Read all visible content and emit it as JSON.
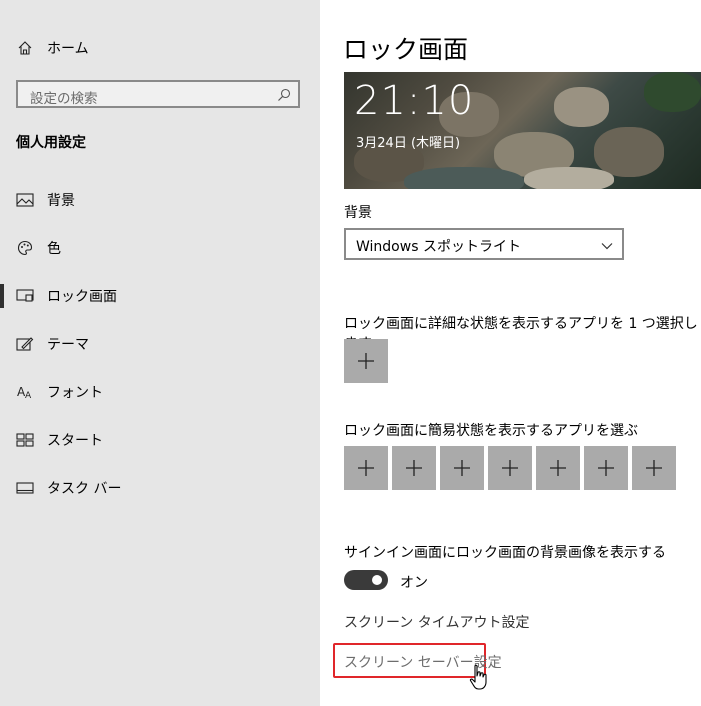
{
  "sidebar": {
    "home": {
      "label": "ホーム",
      "icon": "home-icon"
    },
    "search": {
      "placeholder": "設定の検索",
      "icon": "search-icon"
    },
    "group_title": "個人用設定",
    "items": [
      {
        "label": "背景",
        "icon": "image-icon",
        "active": false
      },
      {
        "label": "色",
        "icon": "palette-icon",
        "active": false
      },
      {
        "label": "ロック画面",
        "icon": "lock-screen-icon",
        "active": true
      },
      {
        "label": "テーマ",
        "icon": "theme-brush-icon",
        "active": false
      },
      {
        "label": "フォント",
        "icon": "font-icon",
        "active": false
      },
      {
        "label": "スタート",
        "icon": "start-grid-icon",
        "active": false
      },
      {
        "label": "タスク バー",
        "icon": "taskbar-icon",
        "active": false
      }
    ]
  },
  "main": {
    "title": "ロック画面",
    "preview": {
      "time": "21:10",
      "date": "3月24日 (木曜日)"
    },
    "background": {
      "label": "背景",
      "value": "Windows スポットライト"
    },
    "detailed_status": {
      "label": "ロック画面に詳細な状態を表示するアプリを 1 つ選択します",
      "buttons": 1
    },
    "quick_status": {
      "label": "ロック画面に簡易状態を表示するアプリを選ぶ",
      "buttons": 7
    },
    "signin_bg": {
      "label": "サインイン画面にロック画面の背景画像を表示する",
      "toggle_label": "オン",
      "on": true
    },
    "links": {
      "screen_timeout": "スクリーン タイムアウト設定",
      "screen_saver": "スクリーン セーバー設定"
    }
  },
  "colors": {
    "sidebar_bg": "#e6e6e6",
    "button_bg": "#aaaaaa",
    "highlight": "#e0262a",
    "toggle_on": "#3a3a3a"
  }
}
